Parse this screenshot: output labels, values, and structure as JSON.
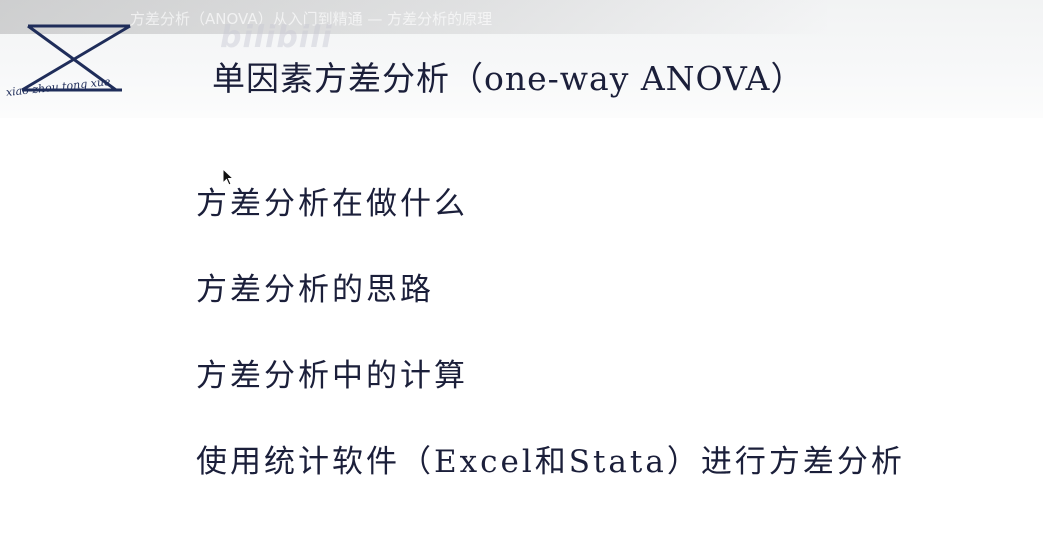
{
  "overlay": {
    "text": "方差分析（ANOVA）从入门到精通 — 方差分析的原理"
  },
  "watermark": {
    "text": "bilibili"
  },
  "logo": {
    "caption": "xiao zhou tong xue",
    "color": "#1f2d5a"
  },
  "slide": {
    "title": "单因素方差分析（one-way ANOVA）",
    "items": [
      "方差分析在做什么",
      "方差分析的思路",
      "方差分析中的计算",
      "使用统计软件（Excel和Stata）进行方差分析"
    ],
    "text_color": "#1b1f3a"
  }
}
